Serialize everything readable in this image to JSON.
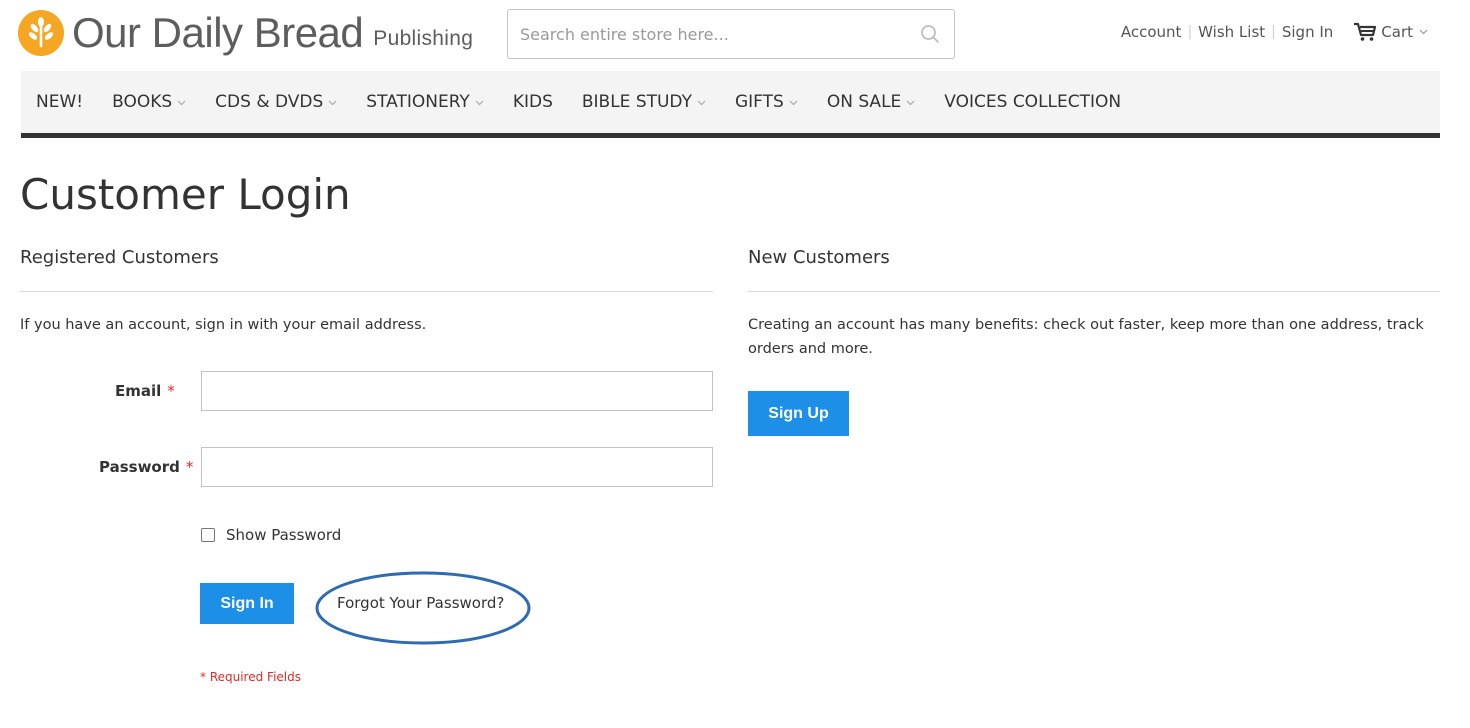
{
  "brand": {
    "name": "Our Daily Bread",
    "sub": "Publishing",
    "accent": "#f5a623"
  },
  "search": {
    "placeholder": "Search entire store here..."
  },
  "toplinks": {
    "account": "Account",
    "wishlist": "Wish List",
    "signin": "Sign In",
    "cart": "Cart"
  },
  "nav": {
    "items": [
      {
        "label": "NEW!",
        "dropdown": false
      },
      {
        "label": "BOOKS",
        "dropdown": true
      },
      {
        "label": "CDS & DVDS",
        "dropdown": true
      },
      {
        "label": "STATIONERY",
        "dropdown": true
      },
      {
        "label": "KIDS",
        "dropdown": false
      },
      {
        "label": "BIBLE STUDY",
        "dropdown": true
      },
      {
        "label": "GIFTS",
        "dropdown": true
      },
      {
        "label": "ON SALE",
        "dropdown": true
      },
      {
        "label": "VOICES COLLECTION",
        "dropdown": false
      }
    ]
  },
  "page": {
    "title": "Customer Login"
  },
  "registered": {
    "title": "Registered Customers",
    "text": "If you have an account, sign in with your email address.",
    "email_label": "Email",
    "password_label": "Password",
    "required_mark": "*",
    "email_value": "",
    "password_value": "",
    "show_password": "Show Password",
    "signin_button": "Sign In",
    "forgot_link": "Forgot Your Password?",
    "required_note": "* Required Fields"
  },
  "newcustomers": {
    "title": "New Customers",
    "text": "Creating an account has many benefits: check out faster, keep more than one address, track orders and more.",
    "signup_button": "Sign Up"
  },
  "colors": {
    "primary_button": "#1e8fe6",
    "required": "#e02b27",
    "annotation_circle": "#2e6bb0"
  }
}
